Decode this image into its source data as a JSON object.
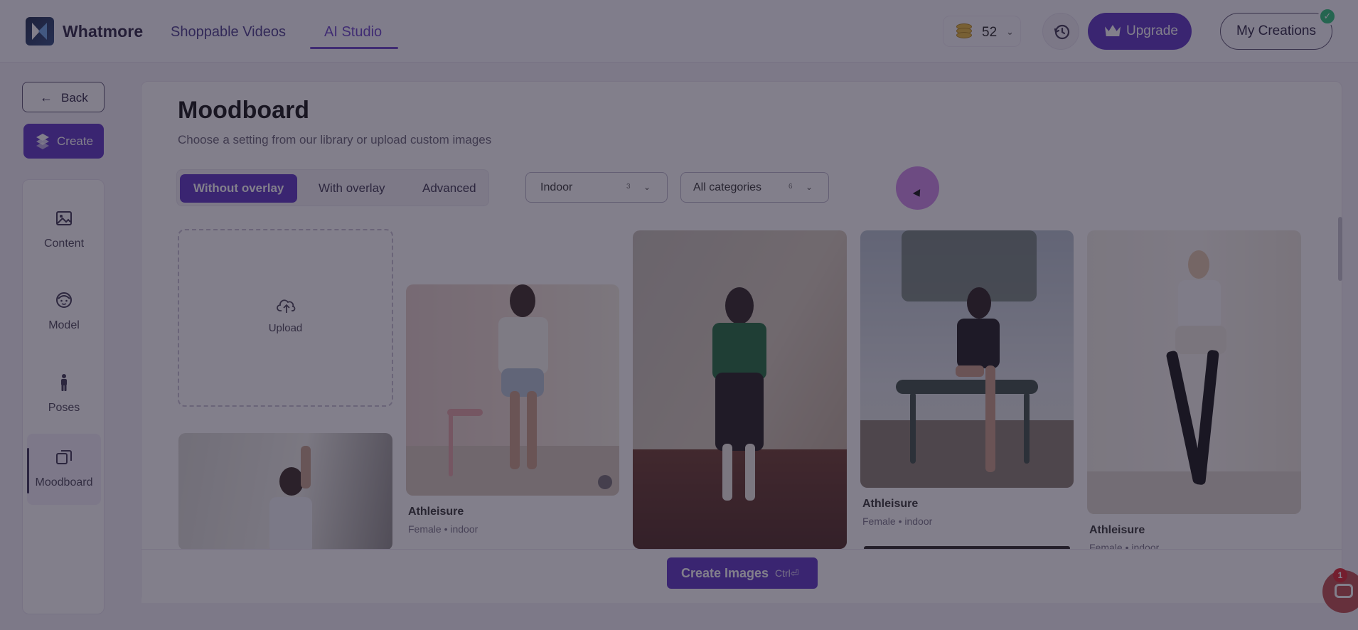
{
  "app": {
    "name": "Whatmore"
  },
  "nav": {
    "links": [
      {
        "label": "Shoppable Videos"
      },
      {
        "label": "AI Studio"
      }
    ]
  },
  "header": {
    "credits": "52",
    "upgrade_label": "Upgrade",
    "my_creations_label": "My Creations"
  },
  "sidebar": {
    "back_label": "Back",
    "create_label": "Create",
    "items": [
      {
        "label": "Content",
        "icon": "image-icon"
      },
      {
        "label": "Model",
        "icon": "face-icon"
      },
      {
        "label": "Poses",
        "icon": "person-icon"
      },
      {
        "label": "Moodboard",
        "icon": "moodboard-icon"
      }
    ]
  },
  "page": {
    "title": "Moodboard",
    "subtitle": "Choose a setting from our library or upload custom images"
  },
  "tabs": [
    {
      "label": "Without overlay"
    },
    {
      "label": "With overlay"
    },
    {
      "label": "Advanced"
    }
  ],
  "filters": {
    "location": {
      "value": "Indoor",
      "count": "3"
    },
    "category": {
      "value": "All categories",
      "count": "6"
    }
  },
  "upload": {
    "label": "Upload"
  },
  "cards": [
    {
      "title": "Athleisure",
      "meta": "Female • indoor"
    },
    {
      "title": "Athleisure",
      "meta": "Female • indoor"
    },
    {
      "title": "Athleisure",
      "meta": "Female • indoor"
    }
  ],
  "footer": {
    "create_images_label": "Create Images",
    "shortcut": "Ctrl⏎"
  },
  "chat": {
    "badge": "1"
  },
  "colors": {
    "brand_purple": "#5c34c4",
    "overlay": "rgba(32,27,48,0.56)"
  }
}
